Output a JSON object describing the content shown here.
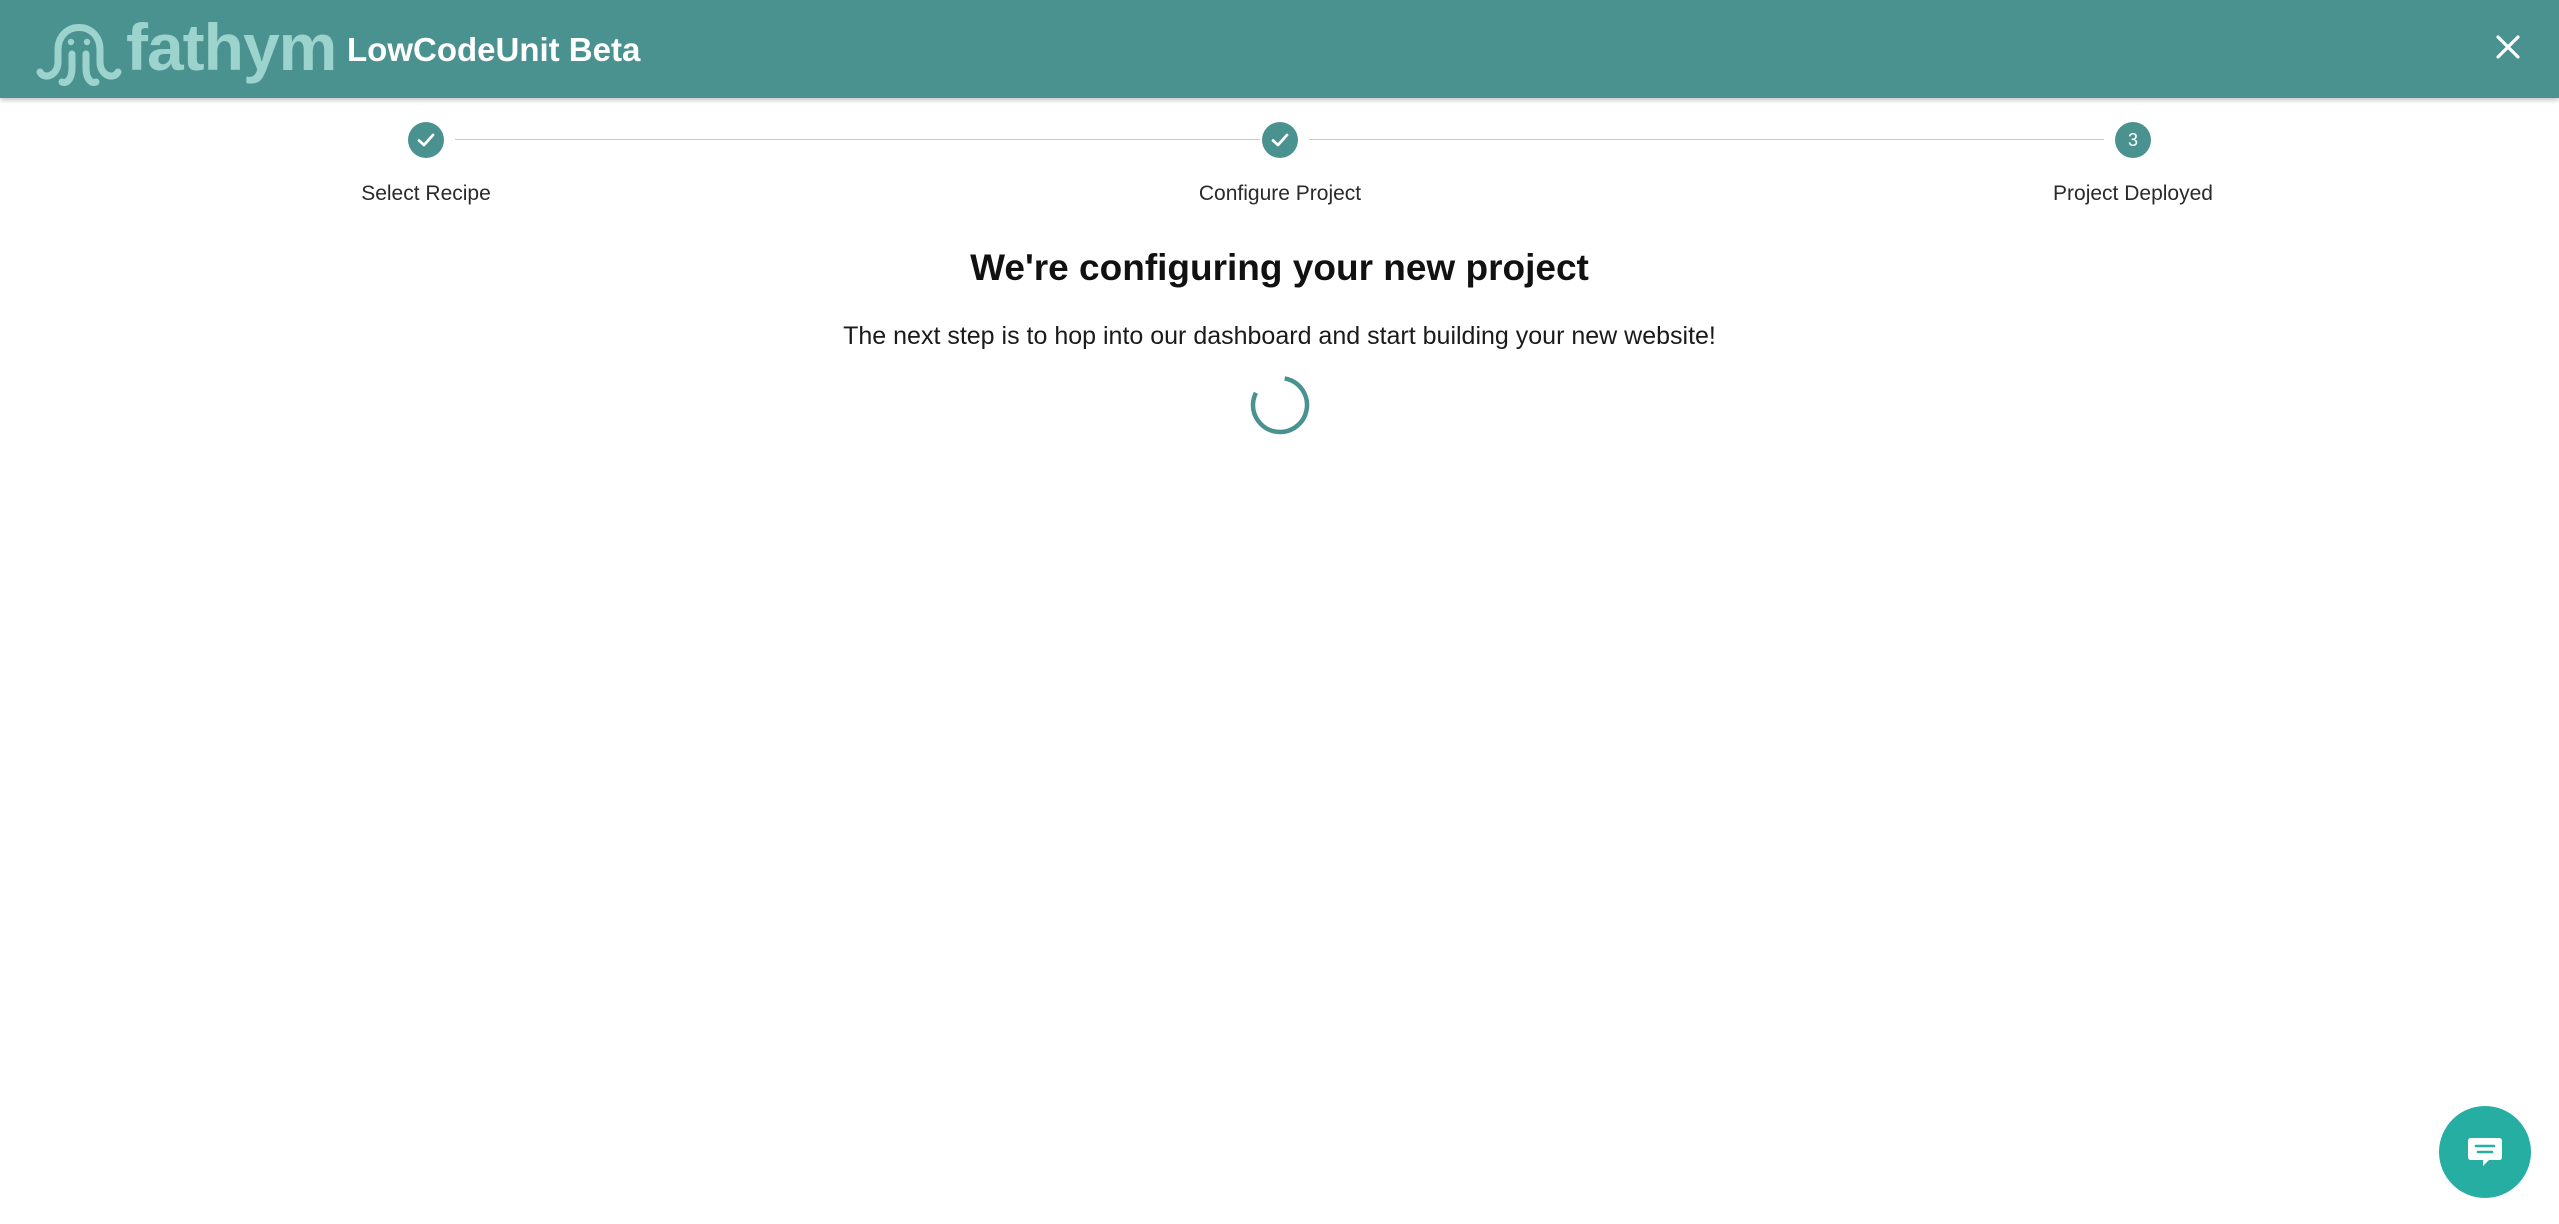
{
  "header": {
    "logo_text": "fathym",
    "app_title": "LowCodeUnit Beta",
    "close_icon": "close-icon"
  },
  "stepper": {
    "steps": [
      {
        "label": "Select Recipe",
        "state": "completed",
        "icon": "check-icon"
      },
      {
        "label": "Configure Project",
        "state": "completed",
        "icon": "check-icon"
      },
      {
        "label": "Project Deployed",
        "state": "active",
        "number": "3"
      }
    ]
  },
  "main": {
    "heading": "We're configuring your new project",
    "subtext": "The next step is to hop into our dashboard and start building your new website!",
    "loading_icon": "spinner-icon"
  },
  "chat": {
    "icon": "chat-icon"
  },
  "colors": {
    "brand": "#4a9290",
    "logo": "#9cd3cd",
    "chat": "#26aea3"
  }
}
